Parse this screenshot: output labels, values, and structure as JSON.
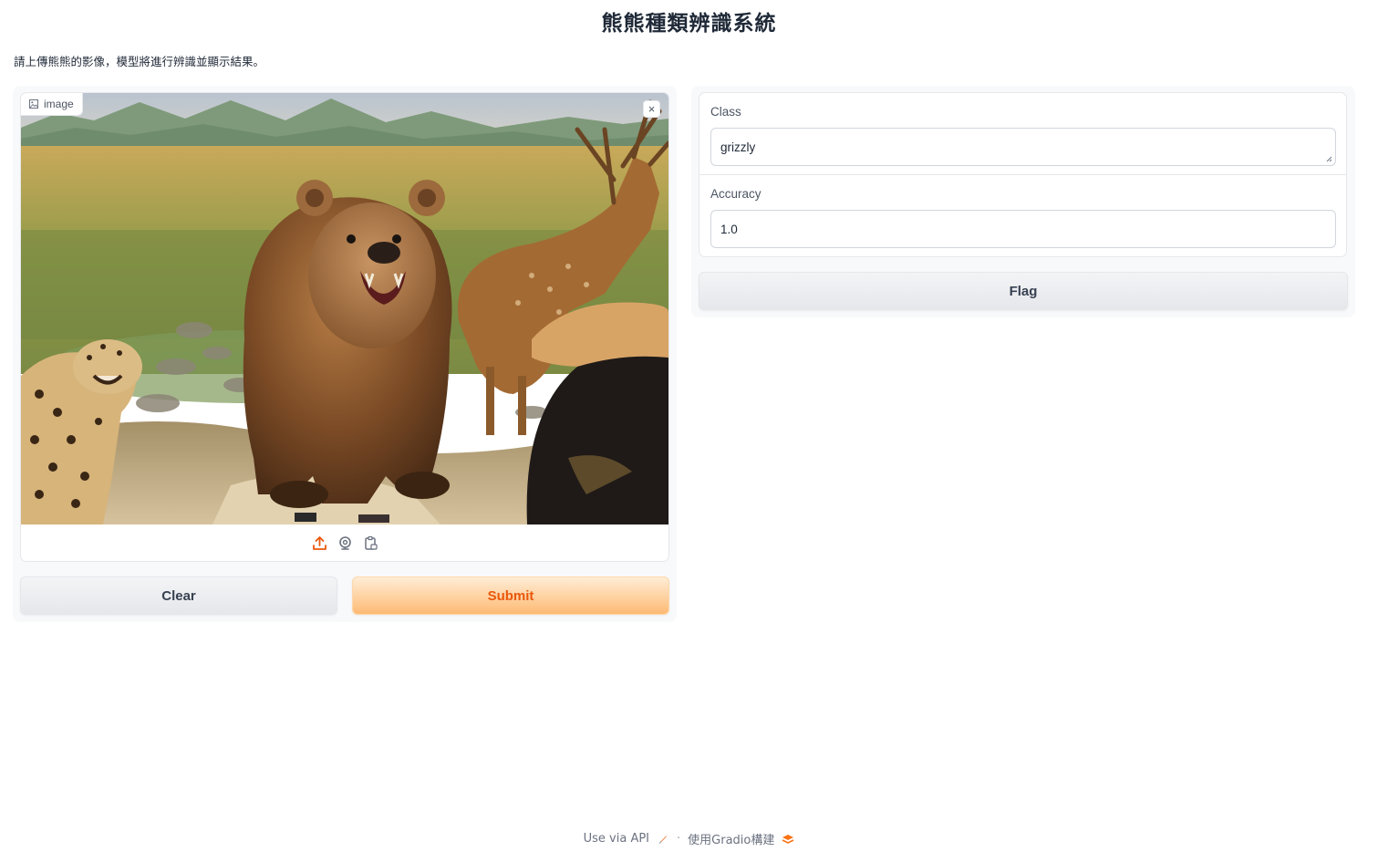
{
  "header": {
    "title": "熊熊種類辨識系統",
    "description": "請上傳熊熊的影像，模型將進行辨識並顯示結果。"
  },
  "input": {
    "image_label": "image",
    "close_symbol": "×",
    "tools": [
      "upload-icon",
      "webcam-icon",
      "clipboard-icon"
    ],
    "clear_label": "Clear",
    "submit_label": "Submit"
  },
  "output": {
    "class_label": "Class",
    "class_value": "grizzly",
    "accuracy_label": "Accuracy",
    "accuracy_value": "1.0",
    "flag_label": "Flag"
  },
  "footer": {
    "api_label": "Use via API",
    "separator": "·",
    "built_label": "使用Gradio構建"
  },
  "colors": {
    "accent": "#ea580c",
    "submit_bg": "#fdba74",
    "panel_bg": "#f8f9fb",
    "border": "#e5e7eb"
  }
}
